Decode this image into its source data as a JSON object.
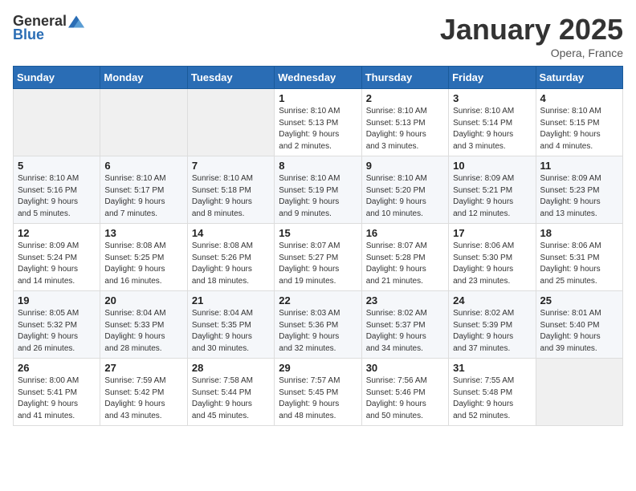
{
  "header": {
    "logo_general": "General",
    "logo_blue": "Blue",
    "month": "January 2025",
    "location": "Opera, France"
  },
  "weekdays": [
    "Sunday",
    "Monday",
    "Tuesday",
    "Wednesday",
    "Thursday",
    "Friday",
    "Saturday"
  ],
  "weeks": [
    [
      {
        "day": "",
        "info": ""
      },
      {
        "day": "",
        "info": ""
      },
      {
        "day": "",
        "info": ""
      },
      {
        "day": "1",
        "info": "Sunrise: 8:10 AM\nSunset: 5:13 PM\nDaylight: 9 hours\nand 2 minutes."
      },
      {
        "day": "2",
        "info": "Sunrise: 8:10 AM\nSunset: 5:13 PM\nDaylight: 9 hours\nand 3 minutes."
      },
      {
        "day": "3",
        "info": "Sunrise: 8:10 AM\nSunset: 5:14 PM\nDaylight: 9 hours\nand 3 minutes."
      },
      {
        "day": "4",
        "info": "Sunrise: 8:10 AM\nSunset: 5:15 PM\nDaylight: 9 hours\nand 4 minutes."
      }
    ],
    [
      {
        "day": "5",
        "info": "Sunrise: 8:10 AM\nSunset: 5:16 PM\nDaylight: 9 hours\nand 5 minutes."
      },
      {
        "day": "6",
        "info": "Sunrise: 8:10 AM\nSunset: 5:17 PM\nDaylight: 9 hours\nand 7 minutes."
      },
      {
        "day": "7",
        "info": "Sunrise: 8:10 AM\nSunset: 5:18 PM\nDaylight: 9 hours\nand 8 minutes."
      },
      {
        "day": "8",
        "info": "Sunrise: 8:10 AM\nSunset: 5:19 PM\nDaylight: 9 hours\nand 9 minutes."
      },
      {
        "day": "9",
        "info": "Sunrise: 8:10 AM\nSunset: 5:20 PM\nDaylight: 9 hours\nand 10 minutes."
      },
      {
        "day": "10",
        "info": "Sunrise: 8:09 AM\nSunset: 5:21 PM\nDaylight: 9 hours\nand 12 minutes."
      },
      {
        "day": "11",
        "info": "Sunrise: 8:09 AM\nSunset: 5:23 PM\nDaylight: 9 hours\nand 13 minutes."
      }
    ],
    [
      {
        "day": "12",
        "info": "Sunrise: 8:09 AM\nSunset: 5:24 PM\nDaylight: 9 hours\nand 14 minutes."
      },
      {
        "day": "13",
        "info": "Sunrise: 8:08 AM\nSunset: 5:25 PM\nDaylight: 9 hours\nand 16 minutes."
      },
      {
        "day": "14",
        "info": "Sunrise: 8:08 AM\nSunset: 5:26 PM\nDaylight: 9 hours\nand 18 minutes."
      },
      {
        "day": "15",
        "info": "Sunrise: 8:07 AM\nSunset: 5:27 PM\nDaylight: 9 hours\nand 19 minutes."
      },
      {
        "day": "16",
        "info": "Sunrise: 8:07 AM\nSunset: 5:28 PM\nDaylight: 9 hours\nand 21 minutes."
      },
      {
        "day": "17",
        "info": "Sunrise: 8:06 AM\nSunset: 5:30 PM\nDaylight: 9 hours\nand 23 minutes."
      },
      {
        "day": "18",
        "info": "Sunrise: 8:06 AM\nSunset: 5:31 PM\nDaylight: 9 hours\nand 25 minutes."
      }
    ],
    [
      {
        "day": "19",
        "info": "Sunrise: 8:05 AM\nSunset: 5:32 PM\nDaylight: 9 hours\nand 26 minutes."
      },
      {
        "day": "20",
        "info": "Sunrise: 8:04 AM\nSunset: 5:33 PM\nDaylight: 9 hours\nand 28 minutes."
      },
      {
        "day": "21",
        "info": "Sunrise: 8:04 AM\nSunset: 5:35 PM\nDaylight: 9 hours\nand 30 minutes."
      },
      {
        "day": "22",
        "info": "Sunrise: 8:03 AM\nSunset: 5:36 PM\nDaylight: 9 hours\nand 32 minutes."
      },
      {
        "day": "23",
        "info": "Sunrise: 8:02 AM\nSunset: 5:37 PM\nDaylight: 9 hours\nand 34 minutes."
      },
      {
        "day": "24",
        "info": "Sunrise: 8:02 AM\nSunset: 5:39 PM\nDaylight: 9 hours\nand 37 minutes."
      },
      {
        "day": "25",
        "info": "Sunrise: 8:01 AM\nSunset: 5:40 PM\nDaylight: 9 hours\nand 39 minutes."
      }
    ],
    [
      {
        "day": "26",
        "info": "Sunrise: 8:00 AM\nSunset: 5:41 PM\nDaylight: 9 hours\nand 41 minutes."
      },
      {
        "day": "27",
        "info": "Sunrise: 7:59 AM\nSunset: 5:42 PM\nDaylight: 9 hours\nand 43 minutes."
      },
      {
        "day": "28",
        "info": "Sunrise: 7:58 AM\nSunset: 5:44 PM\nDaylight: 9 hours\nand 45 minutes."
      },
      {
        "day": "29",
        "info": "Sunrise: 7:57 AM\nSunset: 5:45 PM\nDaylight: 9 hours\nand 48 minutes."
      },
      {
        "day": "30",
        "info": "Sunrise: 7:56 AM\nSunset: 5:46 PM\nDaylight: 9 hours\nand 50 minutes."
      },
      {
        "day": "31",
        "info": "Sunrise: 7:55 AM\nSunset: 5:48 PM\nDaylight: 9 hours\nand 52 minutes."
      },
      {
        "day": "",
        "info": ""
      }
    ]
  ]
}
